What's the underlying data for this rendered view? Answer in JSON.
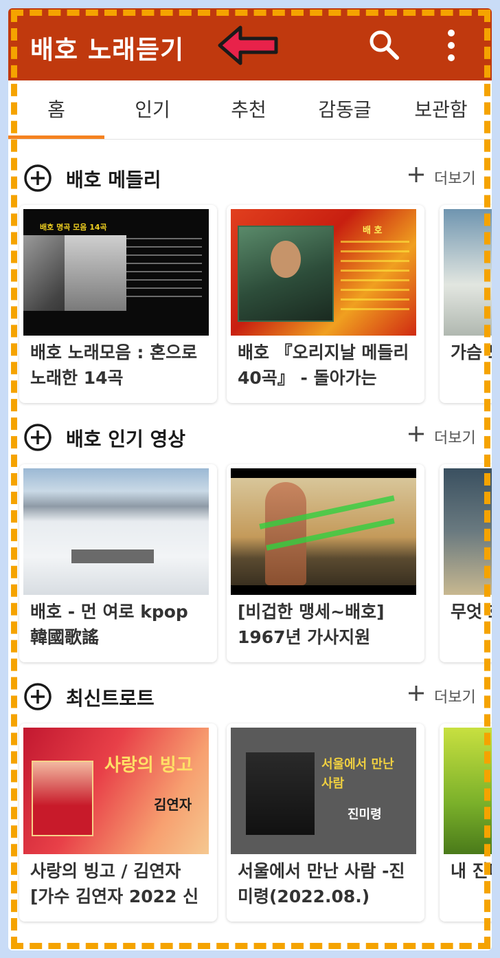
{
  "app": {
    "title": "배호 노래듣기"
  },
  "tabs": [
    {
      "label": "홈",
      "active": true
    },
    {
      "label": "인기"
    },
    {
      "label": "추천"
    },
    {
      "label": "감동글"
    },
    {
      "label": "보관함"
    }
  ],
  "more_label": "더보기",
  "sections": [
    {
      "title": "배호 메들리",
      "cards": [
        {
          "title": "배호 노래모음 : 혼으로 노래한 14곡",
          "thumb_text": "배호 명곡 모음 14곡"
        },
        {
          "title": "배호 『오리지날 메들리 40곡』 - 돌아가는",
          "thumb_text": "배 호"
        },
        {
          "title": "가슴 노래"
        }
      ]
    },
    {
      "title": "배호 인기 영상",
      "cards": [
        {
          "title": "배호 - 먼 여로 kpop 韓國歌謠"
        },
        {
          "title": "[비겁한 맹세~배호] 1967년 가사지원"
        },
        {
          "title": "무엇 호"
        }
      ]
    },
    {
      "title": "최신트로트",
      "cards": [
        {
          "title": "사랑의 빙고 / 김연자 [가수 김연자 2022 신",
          "thumb_text": "사랑의 빙고",
          "thumb_sub": "김연자"
        },
        {
          "title": "서울에서 만난 사람 -진미령(2022.08.)",
          "thumb_text": "서울에서 만난 사람",
          "thumb_sub": "진미령"
        },
        {
          "title": "내 진미"
        }
      ]
    }
  ],
  "colors": {
    "appbar": "#c0390e",
    "accent": "#f58220",
    "dash": "#f5a300"
  }
}
